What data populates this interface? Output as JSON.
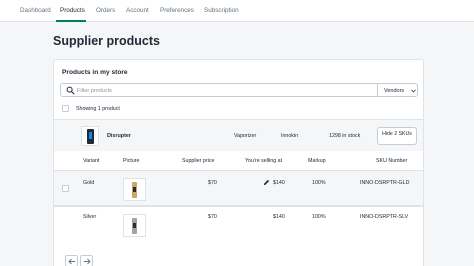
{
  "nav": {
    "tabs": [
      {
        "label": "Dashboard"
      },
      {
        "label": "Products"
      },
      {
        "label": "Orders"
      },
      {
        "label": "Account"
      },
      {
        "label": "Preferences"
      },
      {
        "label": "Subscription"
      }
    ],
    "active_tab": "Products"
  },
  "page": {
    "title": "Supplier products"
  },
  "store_card": {
    "title": "Products in my store",
    "search": {
      "placeholder": "Filter products",
      "value": ""
    },
    "vendors_button": "Vendors",
    "showing": "Showing 1 product",
    "product": {
      "name": "Disrupter",
      "type": "Vaporizer",
      "vendor": "Innokin",
      "stock": "1298 in stock",
      "hide_button": "Hide 2 SKUs"
    },
    "columns": {
      "variant": "Variant",
      "picture": "Picture",
      "supplier_price": "Supplier price",
      "selling_at": "You're selling at",
      "markup": "Markup",
      "sku": "SKU Number"
    },
    "variants": [
      {
        "variant": "Gold",
        "supplier_price": "$70",
        "selling_at": "$140",
        "markup": "100%",
        "sku": "INNO-DSRPTR-GLD"
      },
      {
        "variant": "Silver",
        "supplier_price": "$70",
        "selling_at": "$140",
        "markup": "100%",
        "sku": "INNO-DSRPTR-SLV"
      }
    ]
  },
  "colors": {
    "accent": "#008060",
    "background": "#f4f6f8",
    "border": "#dfe3e8"
  },
  "icons": [
    "search-icon",
    "chevron-down-icon",
    "pencil-icon",
    "arrow-left-icon",
    "arrow-right-icon"
  ]
}
